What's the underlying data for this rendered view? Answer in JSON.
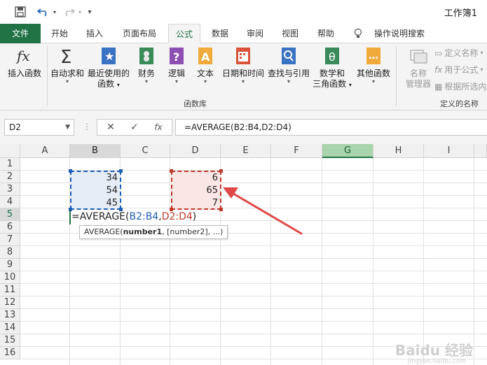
{
  "app": {
    "doc_title": "工作簿1"
  },
  "tabs": [
    {
      "label": "文件"
    },
    {
      "label": "开始"
    },
    {
      "label": "插入"
    },
    {
      "label": "页面布局"
    },
    {
      "label": "公式"
    },
    {
      "label": "数据"
    },
    {
      "label": "审阅"
    },
    {
      "label": "视图"
    },
    {
      "label": "帮助"
    },
    {
      "label": "操作说明搜索"
    }
  ],
  "ribbon": {
    "insert_function": "插入函数",
    "autosum": "自动求和",
    "recent_l1": "最近使用的",
    "recent_l2": "函数",
    "financial": "财务",
    "logical": "逻辑",
    "text": "文本",
    "datetime": "日期和时间",
    "lookup": "查找与引用",
    "math_l1": "数学和",
    "math_l2": "三角函数",
    "more": "其他函数",
    "name_mgr_l1": "名称",
    "name_mgr_l2": "管理器",
    "define_name": "定义名称",
    "use_in_formula": "用于公式",
    "create_from_sel": "根据所选内容",
    "group_library": "函数库",
    "group_names": "定义的名称"
  },
  "formula_bar": {
    "name_box": "D2",
    "formula": "=AVERAGE(B2:B4,D2:D4)"
  },
  "columns": [
    "A",
    "B",
    "C",
    "D",
    "E",
    "F",
    "G",
    "H",
    "I"
  ],
  "rows": [
    "1",
    "2",
    "3",
    "4",
    "5",
    "6",
    "7",
    "8",
    "9",
    "10",
    "11",
    "12",
    "13",
    "14",
    "15",
    "16"
  ],
  "cells": {
    "B2": "34",
    "B3": "54",
    "B4": "45",
    "D2": "6",
    "D3": "65",
    "D4": "7"
  },
  "edit": {
    "prefix": "=AVERAGE(",
    "range1": "B2:B4",
    "comma": ",",
    "range2": "D2:D4",
    "suffix": ")"
  },
  "tooltip": {
    "fn": "AVERAGE(",
    "arg1": "number1",
    "rest": ", [number2], ...)"
  },
  "watermark": {
    "brand": "Baidu 经验",
    "url": "jingyan.baidu.com"
  },
  "colors": {
    "excel_green": "#217346",
    "range1": "#1f5fb5",
    "range2": "#c0392b",
    "arrow": "#e04848"
  }
}
